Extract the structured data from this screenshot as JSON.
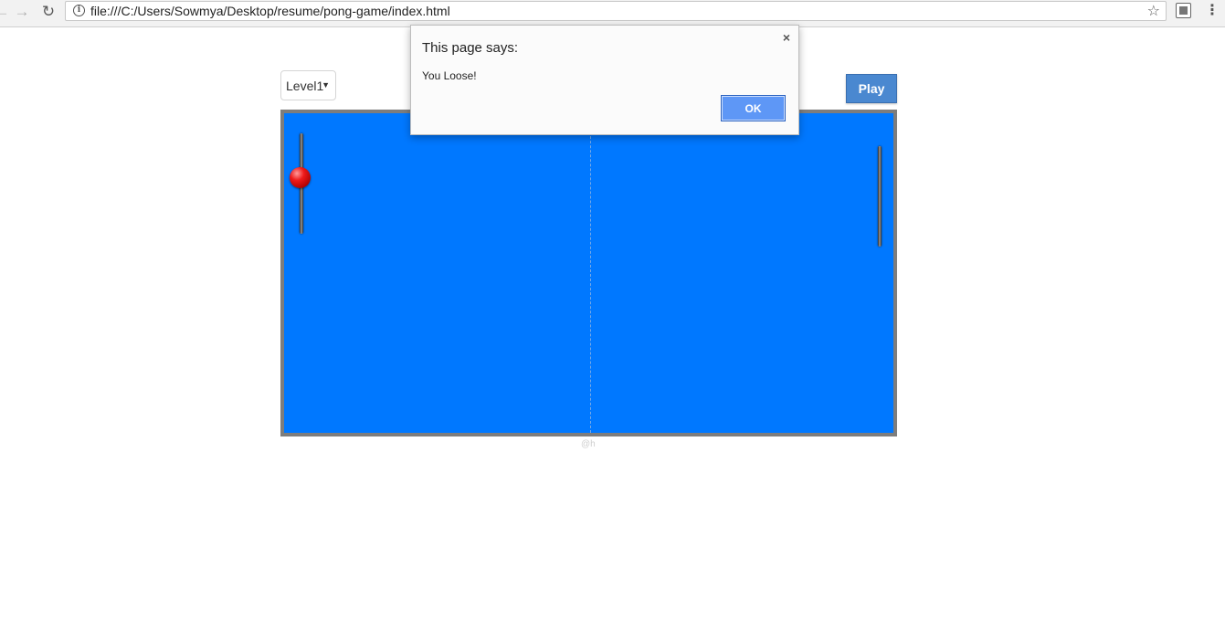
{
  "browser": {
    "url": "file:///C:/Users/Sowmya/Desktop/resume/pong-game/index.html",
    "back_glyph": "←",
    "forward_glyph": "→",
    "reload_glyph": "↻",
    "star_glyph": "☆",
    "menu_glyph": "⋮",
    "icons": [
      "back-arrow-icon",
      "forward-arrow-icon",
      "reload-icon",
      "info-icon",
      "bookmark-star-icon",
      "extension-icon",
      "menu-icon"
    ]
  },
  "game": {
    "level_selected": "Level1",
    "level_caret": "▼",
    "play_label": "Play",
    "footer_mark": "@h",
    "colors": {
      "board": "#0078ff",
      "board_border": "#7d7d7d",
      "ball": "#ee1a1a",
      "play_button": "#4a88d0"
    }
  },
  "dialog": {
    "title": "This page says:",
    "message": "You Loose!",
    "ok_label": "OK",
    "close_glyph": "×"
  }
}
